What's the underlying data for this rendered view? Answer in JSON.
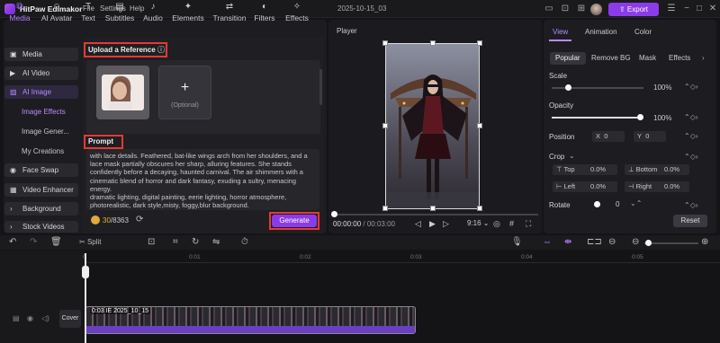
{
  "titlebar": {
    "app_name": "HitPaw Edimakor",
    "menus": [
      "File",
      "Settings",
      "Help"
    ],
    "project_name": "2025-10-15_03",
    "export_label": "Export"
  },
  "top_tabs": [
    {
      "label": "Media",
      "icon": "media-icon"
    },
    {
      "label": "AI Avatar",
      "icon": "avatar-icon"
    },
    {
      "label": "Text",
      "icon": "text-icon"
    },
    {
      "label": "Subtitles",
      "icon": "subtitles-icon"
    },
    {
      "label": "Audio",
      "icon": "audio-icon"
    },
    {
      "label": "Elements",
      "icon": "elements-icon"
    },
    {
      "label": "Transition",
      "icon": "transition-icon"
    },
    {
      "label": "Filters",
      "icon": "filters-icon"
    },
    {
      "label": "Effects",
      "icon": "effects-icon"
    }
  ],
  "sidebar": {
    "items": [
      {
        "label": "Media"
      },
      {
        "label": "AI Video"
      },
      {
        "label": "AI Image"
      },
      {
        "label": "Face Swap"
      },
      {
        "label": "Video Enhancer"
      },
      {
        "label": "Background"
      },
      {
        "label": "Stock Videos"
      }
    ],
    "subitems": [
      "Image Effects",
      "Image Gener...",
      "My Creations"
    ]
  },
  "ai_image": {
    "upload_label": "Upload a Reference",
    "optional_label": "(Optional)",
    "prompt_label": "Prompt",
    "prompt_text": "with lace details. Feathered, bat-like wings arch from her shoulders, and a lace mask partially obscures her sharp, alluring features. She stands confidently before a decaying, haunted carnival. The air shimmers with a cinematic blend of horror and dark fantasy, exuding a sultry, menacing energy.\ndramatic lighting, digital painting, eerie lighting, horror atmosphere, photorealistic, dark style,misty, foggy,blur background.",
    "credits_used": "30",
    "credits_total": "/8363",
    "generate_label": "Generate"
  },
  "player": {
    "label": "Player",
    "current_time": "00:00:00",
    "total_time": "/ 00:03:00",
    "aspect": "9:16"
  },
  "right_panel": {
    "tabs": [
      "View",
      "Animation",
      "Color"
    ],
    "subtabs": [
      "Popular",
      "Remove BG",
      "Mask",
      "Effects"
    ],
    "scale_label": "Scale",
    "scale_value": "100%",
    "opacity_label": "Opacity",
    "opacity_value": "100%",
    "position_label": "Position",
    "pos_x_label": "X",
    "pos_x": "0",
    "pos_y_label": "Y",
    "pos_y": "0",
    "crop_label": "Crop",
    "crop_top_label": "Top",
    "crop_top": "0.0%",
    "crop_bottom_label": "Bottom",
    "crop_bottom": "0.0%",
    "crop_left_label": "Left",
    "crop_left": "0.0%",
    "crop_right_label": "Right",
    "crop_right": "0.0%",
    "rotate_label": "Rotate",
    "rotate_value": "0",
    "reset_label": "Reset"
  },
  "toolbar": {
    "split_label": "Split"
  },
  "timeline": {
    "ruler_ticks": [
      "0",
      "0:01",
      "0:02",
      "0:03",
      "0:04",
      "0:05"
    ],
    "clip_label": "0:03 IE 2025_10_15",
    "cover_label": "Cover"
  },
  "colors": {
    "accent": "#8c3bea",
    "highlight": "#e53935"
  }
}
